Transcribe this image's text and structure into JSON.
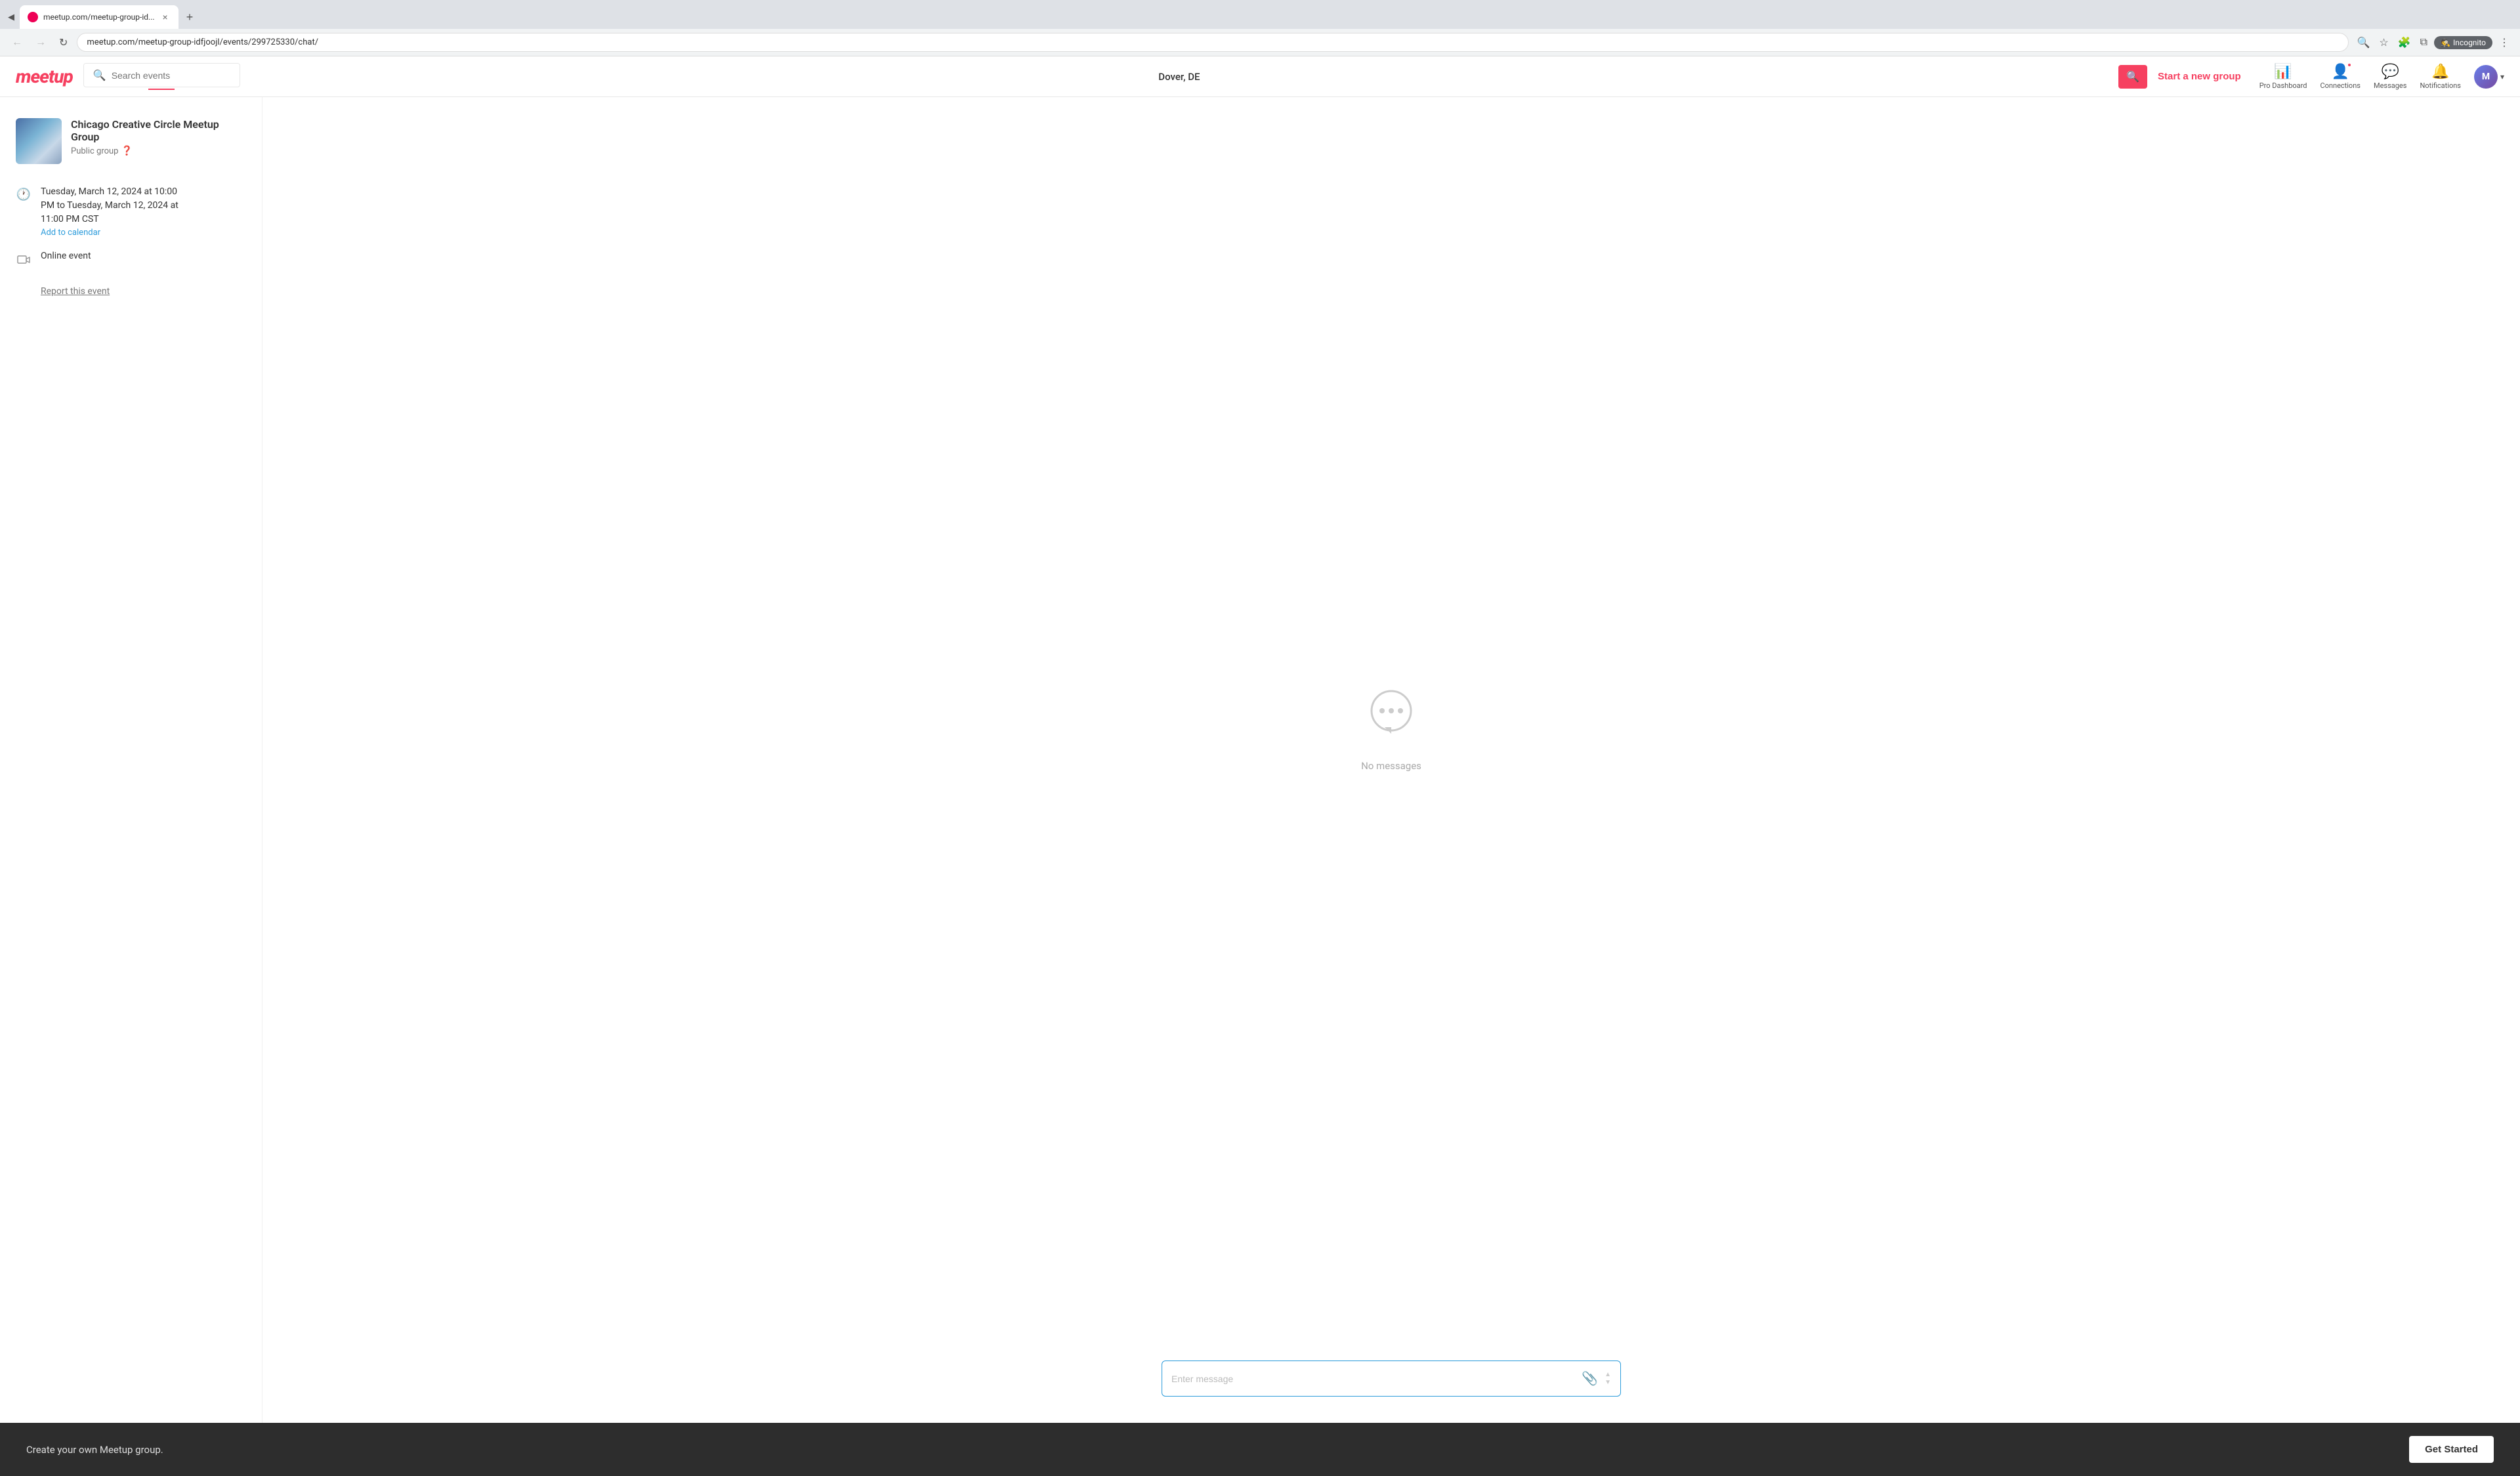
{
  "browser": {
    "tab": {
      "favicon_color": "#e05",
      "title": "meetup.com/meetup-group-id...",
      "close_label": "×"
    },
    "new_tab_label": "+",
    "address": "meetup.com/meetup-group-idfjoojl/events/299725330/chat/",
    "nav": {
      "back_label": "←",
      "forward_label": "→",
      "reload_label": "↻",
      "search_label": "🔍",
      "bookmark_label": "☆",
      "extension_label": "🧩",
      "split_label": "⧉",
      "incognito_label": "Incognito",
      "more_label": "⋮"
    }
  },
  "header": {
    "logo_text": "meetup",
    "search_placeholder": "Search events",
    "location": "Dover, DE",
    "search_btn_icon": "🔍",
    "start_group_label": "Start a new group",
    "nav_items": [
      {
        "id": "pro-dashboard",
        "label": "Pro Dashboard",
        "icon": "📊",
        "has_dot": false
      },
      {
        "id": "connections",
        "label": "Connections",
        "icon": "👤",
        "has_dot": true
      },
      {
        "id": "messages",
        "label": "Messages",
        "icon": "💬",
        "has_dot": false
      },
      {
        "id": "notifications",
        "label": "Notifications",
        "icon": "🔔",
        "has_dot": false
      }
    ],
    "user_avatar_text": "M",
    "chevron": "▾"
  },
  "group": {
    "name": "Chicago Creative Circle Meetup Group",
    "type": "Public group"
  },
  "event": {
    "date_line1": "Tuesday, March 12, 2024 at 10:00",
    "date_line2": "PM to Tuesday, March 12, 2024 at",
    "date_line3": "11:00 PM CST",
    "add_calendar_label": "Add to calendar",
    "location_type": "Online event",
    "report_label": "Report this event"
  },
  "chat": {
    "no_messages_label": "No messages",
    "message_placeholder": "Enter message",
    "attach_icon": "📎"
  },
  "footer": {
    "text": "Create your own Meetup group.",
    "cta_label": "Get Started"
  }
}
